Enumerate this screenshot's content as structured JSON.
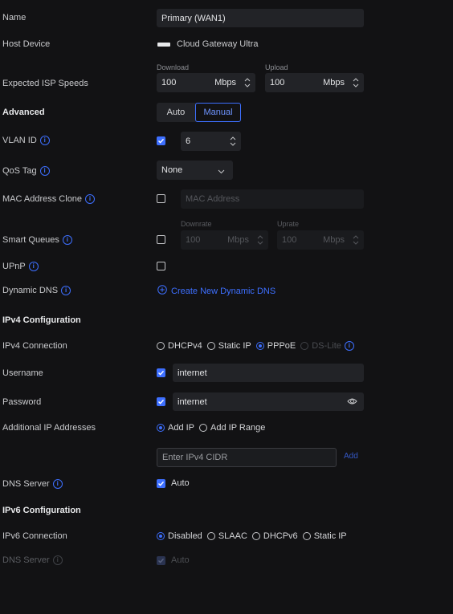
{
  "name": {
    "label": "Name",
    "value": "Primary (WAN1)"
  },
  "host_device": {
    "label": "Host Device",
    "value": "Cloud Gateway Ultra"
  },
  "isp_speeds": {
    "label": "Expected ISP Speeds",
    "download_label": "Download",
    "download_value": "100",
    "download_unit": "Mbps",
    "upload_label": "Upload",
    "upload_value": "100",
    "upload_unit": "Mbps"
  },
  "advanced": {
    "label": "Advanced",
    "options": [
      "Auto",
      "Manual"
    ],
    "selected": "Manual"
  },
  "vlan": {
    "label": "VLAN ID",
    "checked": true,
    "value": "6"
  },
  "qos": {
    "label": "QoS Tag",
    "value": "None"
  },
  "mac_clone": {
    "label": "MAC Address Clone",
    "checked": false,
    "placeholder": "MAC Address"
  },
  "smart_queues": {
    "label": "Smart Queues",
    "checked": false,
    "downrate_label": "Downrate",
    "downrate_value": "100",
    "downrate_unit": "Mbps",
    "uprate_label": "Uprate",
    "uprate_value": "100",
    "uprate_unit": "Mbps"
  },
  "upnp": {
    "label": "UPnP",
    "checked": false
  },
  "dynamic_dns": {
    "label": "Dynamic DNS",
    "link": "Create New Dynamic DNS"
  },
  "ipv4": {
    "heading": "IPv4 Configuration",
    "connection_label": "IPv4 Connection",
    "connection_options": [
      "DHCPv4",
      "Static IP",
      "PPPoE",
      "DS-Lite"
    ],
    "connection_selected": "PPPoE",
    "username_label": "Username",
    "username_value": "internet",
    "password_label": "Password",
    "password_value": "internet",
    "additional_label": "Additional IP Addresses",
    "additional_options": [
      "Add IP",
      "Add IP Range"
    ],
    "additional_selected": "Add IP",
    "cidr_placeholder": "Enter IPv4 CIDR",
    "add_label": "Add",
    "dns_label": "DNS Server",
    "dns_auto": "Auto"
  },
  "ipv6": {
    "heading": "IPv6 Configuration",
    "connection_label": "IPv6 Connection",
    "connection_options": [
      "Disabled",
      "SLAAC",
      "DHCPv6",
      "Static IP"
    ],
    "connection_selected": "Disabled",
    "dns_label": "DNS Server",
    "dns_auto": "Auto"
  },
  "colors": {
    "accent": "#3d6fff",
    "background": "#121214",
    "field": "#222327"
  }
}
